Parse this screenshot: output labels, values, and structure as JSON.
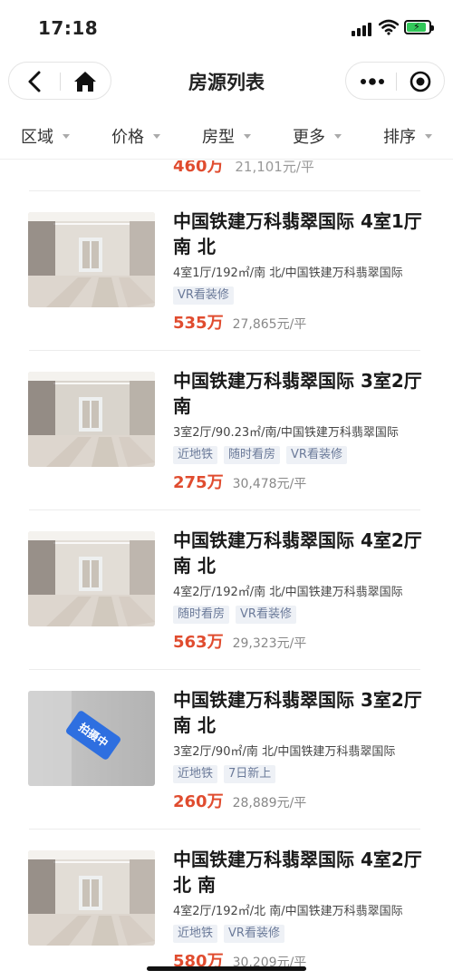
{
  "status": {
    "time": "17:18"
  },
  "nav": {
    "title": "房源列表"
  },
  "filters": [
    "区域",
    "价格",
    "房型",
    "更多",
    "排序"
  ],
  "partial_item": {
    "price": "460万",
    "unit_price": "21,101元/平"
  },
  "listings": [
    {
      "title": "中国铁建万科翡翠国际 4室1厅南 北",
      "desc": "4室1厅/192㎡/南 北/中国铁建万科翡翠国际",
      "tags": [
        "VR看装修"
      ],
      "price": "535万",
      "unit_price": "27,865元/平",
      "photo": "living-room-photo"
    },
    {
      "title": "中国铁建万科翡翠国际 3室2厅 南",
      "desc": "3室2厅/90.23㎡/南/中国铁建万科翡翠国际",
      "tags": [
        "近地铁",
        "随时看房",
        "VR看装修"
      ],
      "price": "275万",
      "unit_price": "30,478元/平",
      "photo": "living-room-photo"
    },
    {
      "title": "中国铁建万科翡翠国际 4室2厅 南 北",
      "desc": "4室2厅/192㎡/南 北/中国铁建万科翡翠国际",
      "tags": [
        "随时看房",
        "VR看装修"
      ],
      "price": "563万",
      "unit_price": "29,323元/平",
      "photo": "living-room-photo"
    },
    {
      "title": "中国铁建万科翡翠国际 3室2厅 南 北",
      "desc": "3室2厅/90㎡/南 北/中国铁建万科翡翠国际",
      "tags": [
        "近地铁",
        "7日新上"
      ],
      "price": "260万",
      "unit_price": "28,889元/平",
      "photo": "placeholder",
      "badge": "拍摄中"
    },
    {
      "title": "中国铁建万科翡翠国际 4室2厅 北 南",
      "desc": "4室2厅/192㎡/北 南/中国铁建万科翡翠国际",
      "tags": [
        "近地铁",
        "VR看装修"
      ],
      "price": "580万",
      "unit_price": "30,209元/平",
      "photo": "living-room-photo"
    }
  ]
}
